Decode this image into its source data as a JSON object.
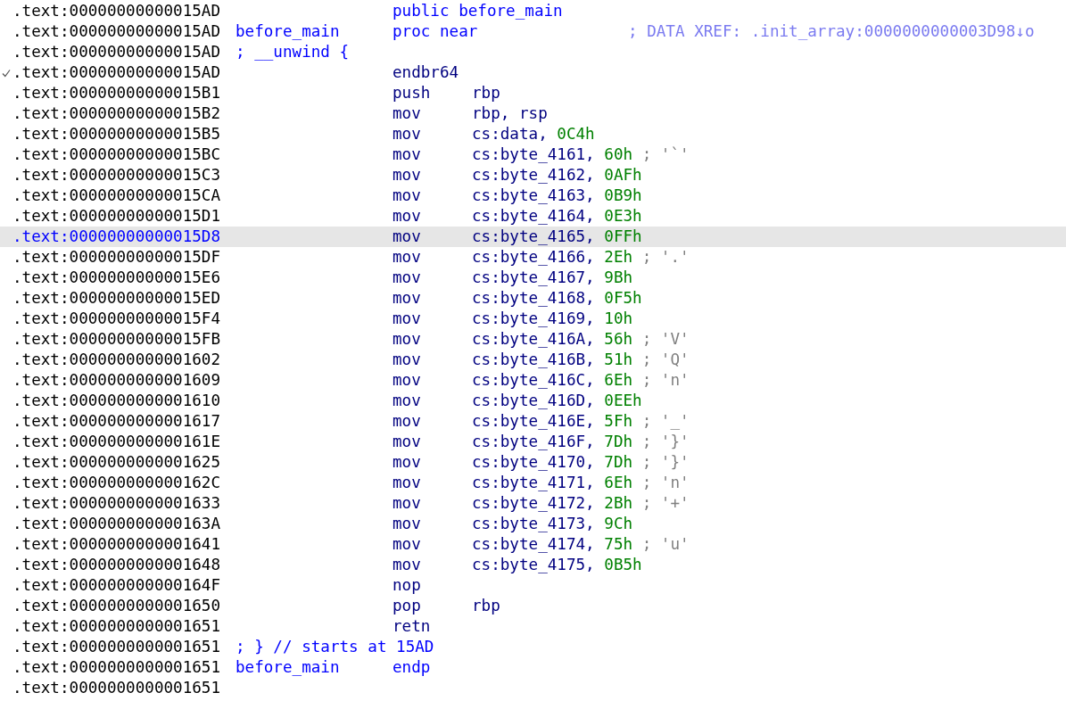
{
  "rows": [
    {
      "address": ".text:00000000000015AD",
      "kind": "directive",
      "checked": false,
      "selected": false,
      "directive": "public before_main"
    },
    {
      "address": ".text:00000000000015AD",
      "kind": "directive",
      "checked": false,
      "selected": false,
      "label": "before_main",
      "directive": "proc near",
      "xref": "; DATA XREF: .init_array:0000000000003D98↓o"
    },
    {
      "address": ".text:00000000000015AD",
      "kind": "comment",
      "checked": false,
      "selected": false,
      "comment": "; __unwind {"
    },
    {
      "address": ".text:00000000000015AD",
      "kind": "instruction",
      "checked": true,
      "selected": false,
      "mnemonic": "endbr64"
    },
    {
      "address": ".text:00000000000015B1",
      "kind": "instruction",
      "checked": false,
      "selected": false,
      "mnemonic": "push",
      "operand": "rbp"
    },
    {
      "address": ".text:00000000000015B2",
      "kind": "instruction",
      "checked": false,
      "selected": false,
      "mnemonic": "mov",
      "operand": "rbp, rsp"
    },
    {
      "address": ".text:00000000000015B5",
      "kind": "instruction",
      "checked": false,
      "selected": false,
      "mnemonic": "mov",
      "operand": "cs:data,",
      "value": "0C4h"
    },
    {
      "address": ".text:00000000000015BC",
      "kind": "instruction",
      "checked": false,
      "selected": false,
      "mnemonic": "mov",
      "operand": "cs:byte_4161,",
      "value": "60h",
      "comment": "; '`'"
    },
    {
      "address": ".text:00000000000015C3",
      "kind": "instruction",
      "checked": false,
      "selected": false,
      "mnemonic": "mov",
      "operand": "cs:byte_4162,",
      "value": "0AFh"
    },
    {
      "address": ".text:00000000000015CA",
      "kind": "instruction",
      "checked": false,
      "selected": false,
      "mnemonic": "mov",
      "operand": "cs:byte_4163,",
      "value": "0B9h"
    },
    {
      "address": ".text:00000000000015D1",
      "kind": "instruction",
      "checked": false,
      "selected": false,
      "mnemonic": "mov",
      "operand": "cs:byte_4164,",
      "value": "0E3h"
    },
    {
      "address": ".text:00000000000015D8",
      "kind": "instruction",
      "checked": false,
      "selected": true,
      "mnemonic": "mov",
      "operand": "cs:byte_4165,",
      "value": "0FFh"
    },
    {
      "address": ".text:00000000000015DF",
      "kind": "instruction",
      "checked": false,
      "selected": false,
      "mnemonic": "mov",
      "operand": "cs:byte_4166,",
      "value": "2Eh",
      "comment": "; '.'"
    },
    {
      "address": ".text:00000000000015E6",
      "kind": "instruction",
      "checked": false,
      "selected": false,
      "mnemonic": "mov",
      "operand": "cs:byte_4167,",
      "value": "9Bh"
    },
    {
      "address": ".text:00000000000015ED",
      "kind": "instruction",
      "checked": false,
      "selected": false,
      "mnemonic": "mov",
      "operand": "cs:byte_4168,",
      "value": "0F5h"
    },
    {
      "address": ".text:00000000000015F4",
      "kind": "instruction",
      "checked": false,
      "selected": false,
      "mnemonic": "mov",
      "operand": "cs:byte_4169,",
      "value": "10h"
    },
    {
      "address": ".text:00000000000015FB",
      "kind": "instruction",
      "checked": false,
      "selected": false,
      "mnemonic": "mov",
      "operand": "cs:byte_416A,",
      "value": "56h",
      "comment": "; 'V'"
    },
    {
      "address": ".text:0000000000001602",
      "kind": "instruction",
      "checked": false,
      "selected": false,
      "mnemonic": "mov",
      "operand": "cs:byte_416B,",
      "value": "51h",
      "comment": "; 'Q'"
    },
    {
      "address": ".text:0000000000001609",
      "kind": "instruction",
      "checked": false,
      "selected": false,
      "mnemonic": "mov",
      "operand": "cs:byte_416C,",
      "value": "6Eh",
      "comment": "; 'n'"
    },
    {
      "address": ".text:0000000000001610",
      "kind": "instruction",
      "checked": false,
      "selected": false,
      "mnemonic": "mov",
      "operand": "cs:byte_416D,",
      "value": "0EEh"
    },
    {
      "address": ".text:0000000000001617",
      "kind": "instruction",
      "checked": false,
      "selected": false,
      "mnemonic": "mov",
      "operand": "cs:byte_416E,",
      "value": "5Fh",
      "comment": "; '_'"
    },
    {
      "address": ".text:000000000000161E",
      "kind": "instruction",
      "checked": false,
      "selected": false,
      "mnemonic": "mov",
      "operand": "cs:byte_416F,",
      "value": "7Dh",
      "comment": "; '}'"
    },
    {
      "address": ".text:0000000000001625",
      "kind": "instruction",
      "checked": false,
      "selected": false,
      "mnemonic": "mov",
      "operand": "cs:byte_4170,",
      "value": "7Dh",
      "comment": "; '}'"
    },
    {
      "address": ".text:000000000000162C",
      "kind": "instruction",
      "checked": false,
      "selected": false,
      "mnemonic": "mov",
      "operand": "cs:byte_4171,",
      "value": "6Eh",
      "comment": "; 'n'"
    },
    {
      "address": ".text:0000000000001633",
      "kind": "instruction",
      "checked": false,
      "selected": false,
      "mnemonic": "mov",
      "operand": "cs:byte_4172,",
      "value": "2Bh",
      "comment": "; '+'"
    },
    {
      "address": ".text:000000000000163A",
      "kind": "instruction",
      "checked": false,
      "selected": false,
      "mnemonic": "mov",
      "operand": "cs:byte_4173,",
      "value": "9Ch"
    },
    {
      "address": ".text:0000000000001641",
      "kind": "instruction",
      "checked": false,
      "selected": false,
      "mnemonic": "mov",
      "operand": "cs:byte_4174,",
      "value": "75h",
      "comment": "; 'u'"
    },
    {
      "address": ".text:0000000000001648",
      "kind": "instruction",
      "checked": false,
      "selected": false,
      "mnemonic": "mov",
      "operand": "cs:byte_4175,",
      "value": "0B5h"
    },
    {
      "address": ".text:000000000000164F",
      "kind": "instruction",
      "checked": false,
      "selected": false,
      "mnemonic": "nop"
    },
    {
      "address": ".text:0000000000001650",
      "kind": "instruction",
      "checked": false,
      "selected": false,
      "mnemonic": "pop",
      "operand": "rbp"
    },
    {
      "address": ".text:0000000000001651",
      "kind": "instruction",
      "checked": false,
      "selected": false,
      "mnemonic": "retn"
    },
    {
      "address": ".text:0000000000001651",
      "kind": "comment",
      "checked": false,
      "selected": false,
      "comment": "; } // starts at 15AD"
    },
    {
      "address": ".text:0000000000001651",
      "kind": "directive",
      "checked": false,
      "selected": false,
      "label": "before_main",
      "directive": "endp"
    },
    {
      "address": ".text:0000000000001651",
      "kind": "blank",
      "checked": false,
      "selected": false
    }
  ]
}
